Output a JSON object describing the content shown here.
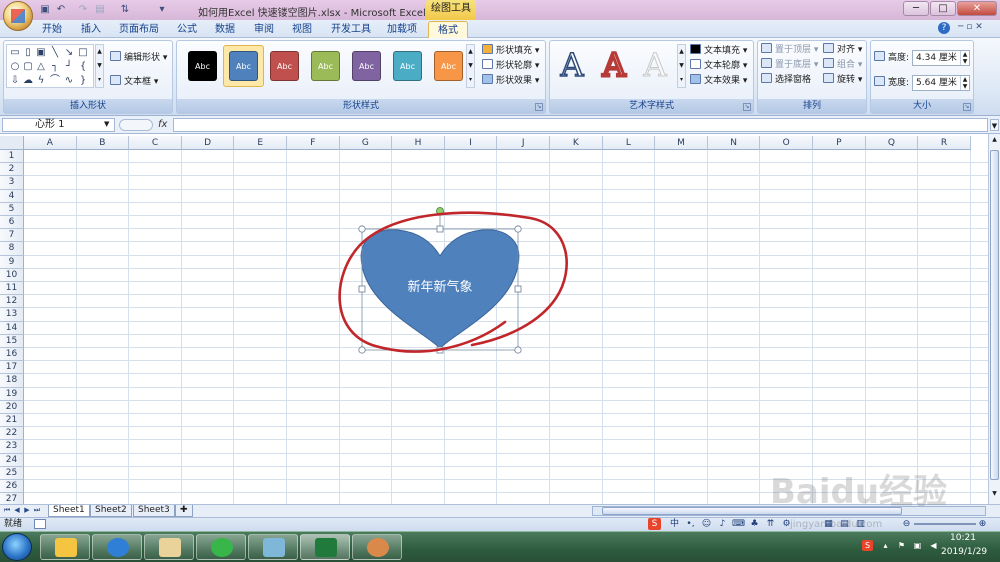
{
  "window": {
    "title": "如何用Excel 快速镂空图片.xlsx - Microsoft Excel",
    "contextual_tab": "绘图工具",
    "min": "─",
    "max": "□",
    "close": "✕"
  },
  "tabs": [
    {
      "label": "开始"
    },
    {
      "label": "插入"
    },
    {
      "label": "页面布局"
    },
    {
      "label": "公式"
    },
    {
      "label": "数据"
    },
    {
      "label": "审阅"
    },
    {
      "label": "视图"
    },
    {
      "label": "开发工具"
    },
    {
      "label": "加载项"
    },
    {
      "label": "格式",
      "active": true
    }
  ],
  "ribbon": {
    "insert_shapes": {
      "label": "插入形状",
      "edit_shape": "编辑形状 ▾",
      "text_box": "文本框 ▾"
    },
    "shape_styles": {
      "label": "形状样式",
      "swatch_text": "Abc",
      "swatches": [
        "#000000",
        "#4f81bd",
        "#c0504d",
        "#9bbb59",
        "#8064a2",
        "#4bacc6",
        "#f79646"
      ],
      "selected_index": 1,
      "fill": "形状填充 ▾",
      "outline": "形状轮廓 ▾",
      "effects": "形状效果 ▾"
    },
    "wordart": {
      "label": "艺术字样式",
      "glyph": "A",
      "text_fill": "文本填充 ▾",
      "text_outline": "文本轮廓 ▾",
      "text_effects": "文本效果 ▾"
    },
    "arrange": {
      "label": "排列",
      "bring_front": "置于顶层 ▾",
      "send_back": "置于底层 ▾",
      "selection_pane": "选择窗格",
      "align": "对齐 ▾",
      "group": "组合 ▾",
      "rotate": "旋转 ▾"
    },
    "size": {
      "label": "大小",
      "height_label": "高度:",
      "height_value": "4.34 厘米",
      "width_label": "宽度:",
      "width_value": "5.64 厘米"
    }
  },
  "formula_bar": {
    "name_box": "心形 1",
    "fx": "fx",
    "value": ""
  },
  "sheet": {
    "columns": [
      "A",
      "B",
      "C",
      "D",
      "E",
      "F",
      "G",
      "H",
      "I",
      "J",
      "K",
      "L",
      "M",
      "N",
      "O",
      "P",
      "Q",
      "R"
    ],
    "rows": [
      "1",
      "2",
      "3",
      "4",
      "5",
      "6",
      "7",
      "8",
      "9",
      "10",
      "11",
      "12",
      "13",
      "14",
      "15",
      "16",
      "17",
      "18",
      "19",
      "20",
      "21",
      "22",
      "23",
      "24",
      "25",
      "26",
      "27"
    ],
    "shape_text": "新年新气象",
    "shape_fill": "#4f81bd",
    "annotation_color": "#c0262a",
    "tabs": [
      "Sheet1",
      "Sheet2",
      "Sheet3"
    ],
    "active_tab": "Sheet1"
  },
  "status": {
    "text": "就绪"
  },
  "taskbar": {
    "time": "10:21",
    "date": "2019/1/29"
  },
  "watermark": {
    "brand": "Baidu经验",
    "url": "jingyan.baidu.com"
  }
}
